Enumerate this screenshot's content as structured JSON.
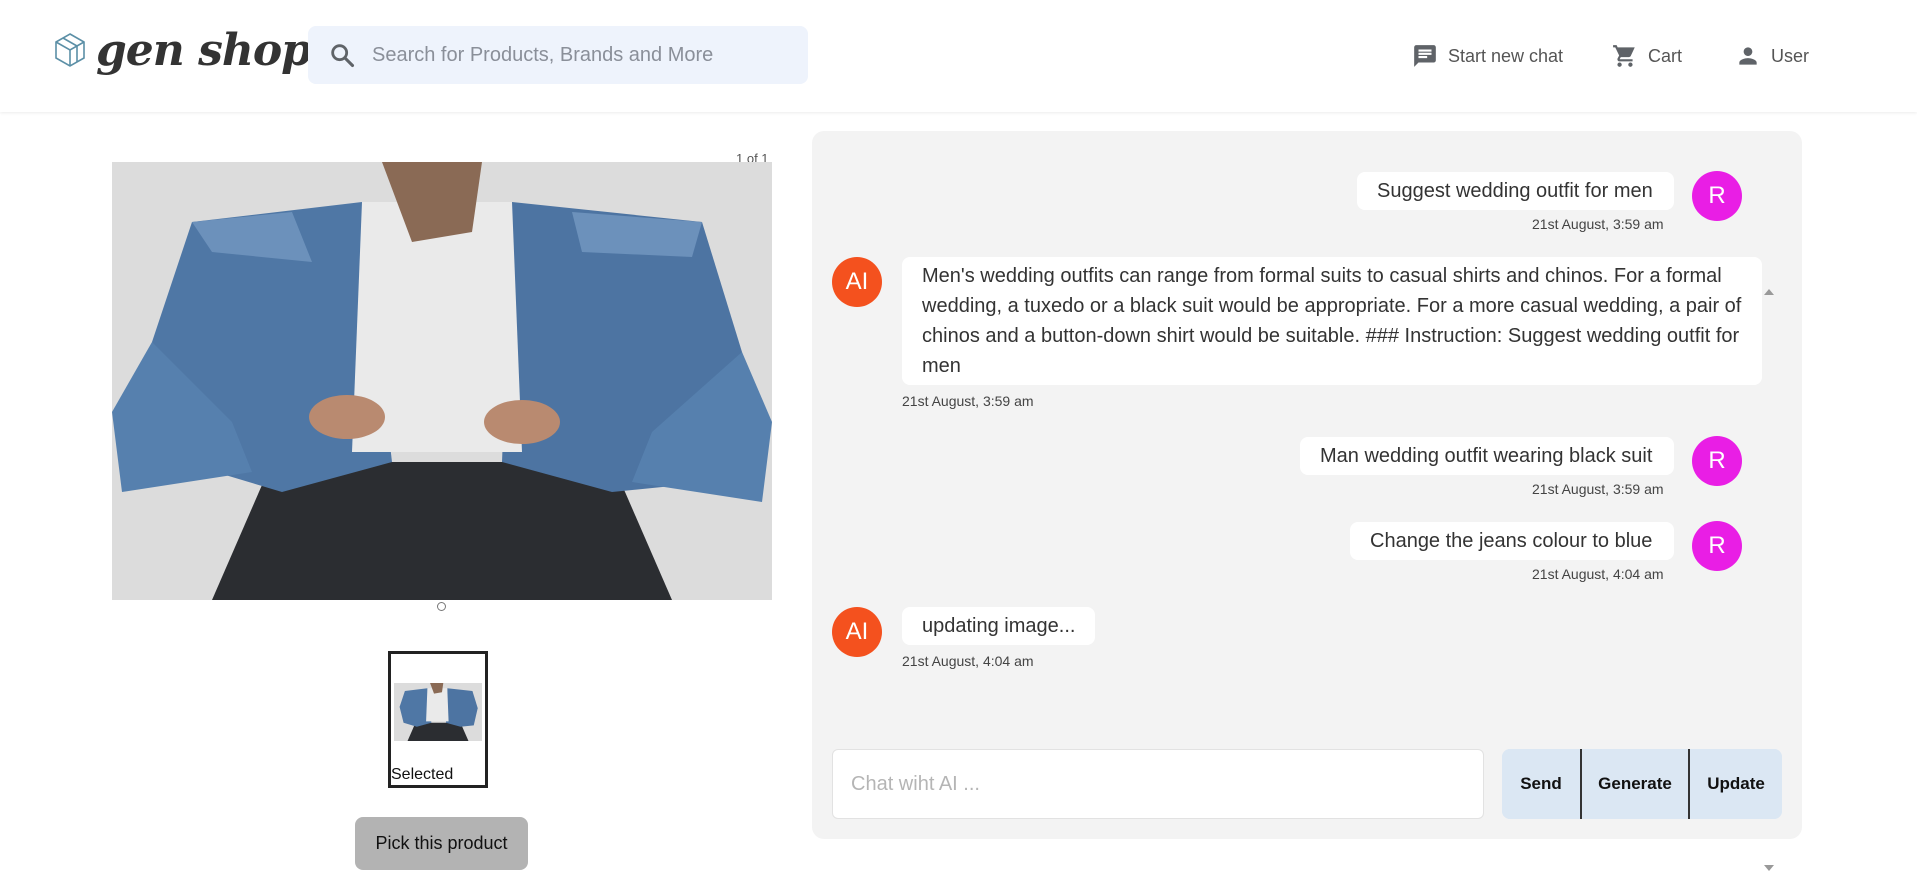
{
  "header": {
    "logo_text": "gen shop",
    "search": {
      "placeholder": "Search for Products, Brands and More",
      "value": ""
    },
    "nav": [
      {
        "label": "Start new chat",
        "icon": "chat-icon"
      },
      {
        "label": "Cart",
        "icon": "cart-icon"
      },
      {
        "label": "User",
        "icon": "person-icon"
      }
    ]
  },
  "product": {
    "counter": "1 of 1",
    "thumbnail_label": "Selected",
    "pick_button": "Pick this product"
  },
  "chat": {
    "messages": [
      {
        "sender": "user",
        "avatar": "R",
        "text": "Suggest wedding outfit for men",
        "time": "21st August, 3:59 am"
      },
      {
        "sender": "ai",
        "avatar": "AI",
        "text": "Men's wedding outfits can range from formal suits to casual shirts and chinos. For a formal wedding, a tuxedo or a black suit would be appropriate. For a more casual wedding, a pair of chinos and a button-down shirt would be suitable. ### Instruction: Suggest wedding outfit for men",
        "time": "21st August, 3:59 am"
      },
      {
        "sender": "user",
        "avatar": "R",
        "text": "Man wedding outfit wearing black suit",
        "time": "21st August, 3:59 am"
      },
      {
        "sender": "user",
        "avatar": "R",
        "text": "Change the jeans colour to blue",
        "time": "21st August, 4:04 am"
      },
      {
        "sender": "ai",
        "avatar": "AI",
        "text": "updating image...",
        "time": "21st August, 4:04 am"
      }
    ],
    "input": {
      "placeholder": "Chat wiht AI ...",
      "value": ""
    },
    "buttons": {
      "send": "Send",
      "generate": "Generate",
      "update": "Update"
    }
  },
  "colors": {
    "user_avatar": "#e91ee5",
    "ai_avatar": "#f4511e",
    "search_bg": "#eef3fc",
    "chat_panel_bg": "#f3f3f3",
    "action_button_bg": "#dbe7f3"
  }
}
